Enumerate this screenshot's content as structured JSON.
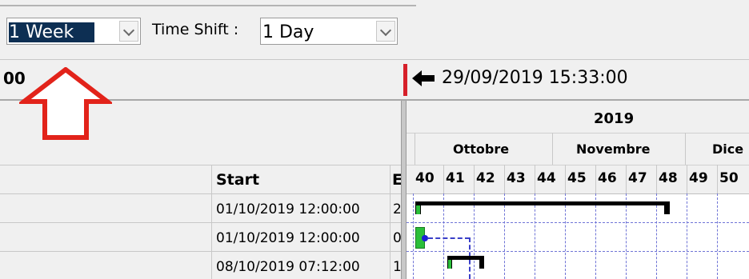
{
  "toolbar": {
    "period_value": "1 Week",
    "time_shift_label": "Time Shift :",
    "time_shift_value": "1 Day"
  },
  "header": {
    "left_partial_text": "00",
    "current_datetime": "29/09/2019 15:33:00"
  },
  "table": {
    "columns": [
      "Start",
      "E"
    ],
    "rows": [
      {
        "start": "01/10/2019 12:00:00",
        "e_partial": "2"
      },
      {
        "start": "01/10/2019 12:00:00",
        "e_partial": "0"
      },
      {
        "start": "08/10/2019 07:12:00",
        "e_partial": "1"
      }
    ]
  },
  "gantt": {
    "year": "2019",
    "months": [
      "Ottobre",
      "Novembre",
      "Dice"
    ],
    "weeks": [
      "40",
      "41",
      "42",
      "43",
      "44",
      "45",
      "46",
      "47",
      "48",
      "49",
      "50"
    ],
    "colors": {
      "summary_bar": "#000000",
      "task_bar": "#2bbf3a",
      "link": "#3a3fc8",
      "grid": "#6f74d6"
    }
  },
  "annotation": {
    "arrow_color": "#e2231a"
  }
}
